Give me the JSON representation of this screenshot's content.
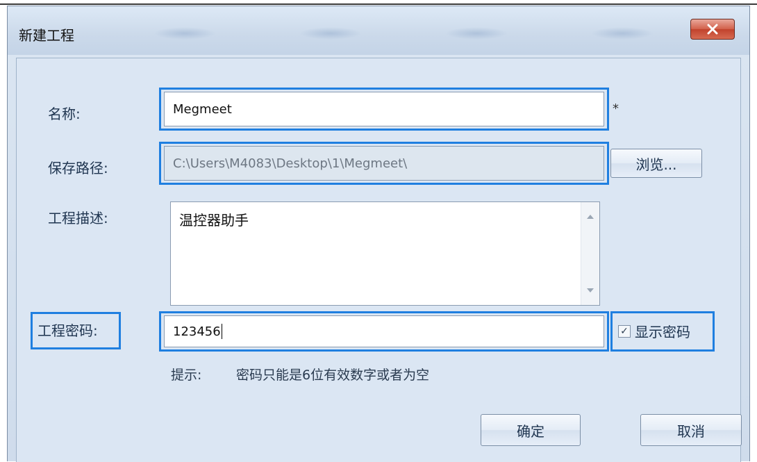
{
  "window": {
    "title": "新建工程",
    "close_label": "x"
  },
  "name": {
    "label": "名称:",
    "value": "Megmeet",
    "required_mark": "*"
  },
  "path": {
    "label": "保存路径:",
    "value": "C:\\Users\\M4083\\Desktop\\1\\Megmeet\\",
    "browse_label": "浏览..."
  },
  "description": {
    "label": "工程描述:",
    "value": "温控器助手"
  },
  "password": {
    "label": "工程密码:",
    "value": "123456",
    "show_password_label": "显示密码",
    "show_password_checked": true
  },
  "hint": {
    "prefix": "提示:",
    "text": "密码只能是6位有效数字或者为空"
  },
  "buttons": {
    "ok": "确定",
    "cancel": "取消"
  },
  "colors": {
    "highlight": "#1f7fe0",
    "close_red": "#c1432d"
  }
}
